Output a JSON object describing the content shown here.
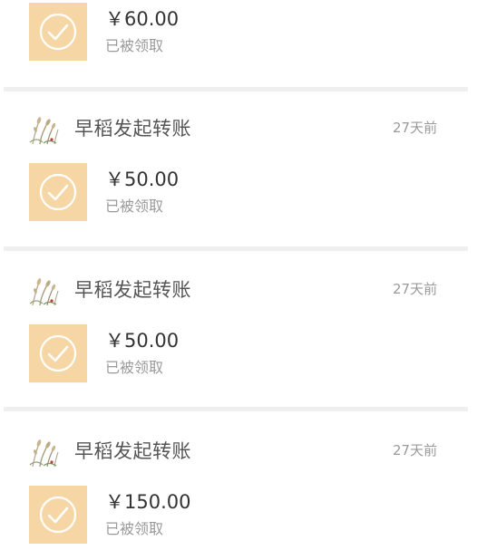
{
  "cards": [
    {
      "amount": "￥60.00",
      "status": "已被领取"
    },
    {
      "sender": "早稻发起转账",
      "time": "27天前",
      "amount": "￥50.00",
      "status": "已被领取"
    },
    {
      "sender": "早稻发起转账",
      "time": "27天前",
      "amount": "￥50.00",
      "status": "已被领取"
    },
    {
      "sender": "早稻发起转账",
      "time": "27天前",
      "amount": "￥150.00",
      "status": "已被领取"
    }
  ],
  "icons": {
    "check": "check-circle-icon",
    "avatar": "wheat-avatar"
  },
  "colors": {
    "check_bg": "#f6d6a4",
    "divider": "#efefef",
    "sender_text": "#555555",
    "amount_text": "#333333",
    "meta_text": "#9a9a9a"
  }
}
